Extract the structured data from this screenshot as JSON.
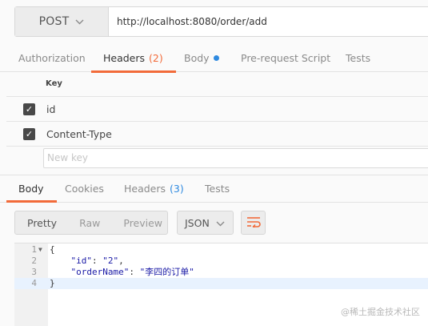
{
  "request": {
    "method": "POST",
    "url": "http://localhost:8080/order/add"
  },
  "request_tabs": [
    {
      "label": "Authorization"
    },
    {
      "label": "Headers",
      "count": "(2)"
    },
    {
      "label": "Body"
    },
    {
      "label": "Pre-request Script"
    },
    {
      "label": "Tests"
    }
  ],
  "headers": {
    "key_column": "Key",
    "rows": [
      {
        "key": "id",
        "checked": true
      },
      {
        "key": "Content-Type",
        "checked": true
      }
    ],
    "new_key_placeholder": "New key"
  },
  "response_tabs": [
    {
      "label": "Body"
    },
    {
      "label": "Cookies"
    },
    {
      "label": "Headers",
      "count": "(3)"
    },
    {
      "label": "Tests"
    }
  ],
  "body_view": {
    "modes": [
      "Pretty",
      "Raw",
      "Preview"
    ],
    "active_mode": "Pretty",
    "format": "JSON"
  },
  "editor": {
    "line_numbers": [
      "1",
      "2",
      "3",
      "4"
    ],
    "lines": [
      {
        "text": "{"
      },
      {
        "key": "\"id\"",
        "value": "\"2\"",
        "trail": ","
      },
      {
        "key": "\"orderName\"",
        "value": "\"李四的订单\"",
        "trail": ""
      },
      {
        "text": "}"
      }
    ]
  },
  "watermark": "@稀土掘金技术社区",
  "colors": {
    "accent": "#f26b3a",
    "link_blue": "#2f8ae0",
    "string": "#1a1aa6"
  }
}
